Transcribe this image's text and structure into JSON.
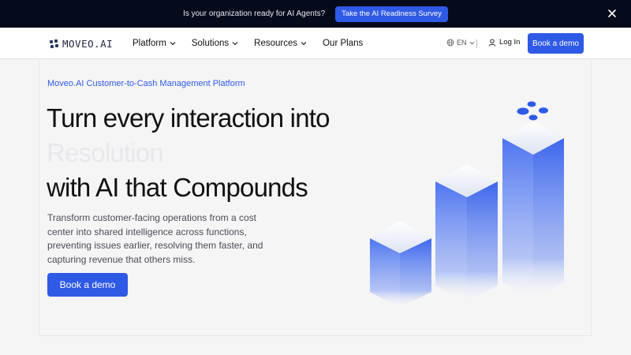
{
  "banner": {
    "text": "Is your organization ready for AI Agents?",
    "cta": "Take the AI Readiness Survey",
    "close_icon": "close-icon"
  },
  "nav": {
    "logo_text": "MOVEO.AI",
    "links": [
      {
        "label": "Platform",
        "has_menu": true
      },
      {
        "label": "Solutions",
        "has_menu": true
      },
      {
        "label": "Resources",
        "has_menu": true
      },
      {
        "label": "Our Plans",
        "has_menu": false
      }
    ],
    "language": "EN",
    "login": "Log In",
    "cta": "Book a demo"
  },
  "hero": {
    "eyebrow": "Moveo.AI Customer-to-Cash Management Platform",
    "title_line1": "Turn every interaction into",
    "title_line2": "Resolution",
    "title_line3": "with AI that Compounds",
    "description": "Transform customer-facing operations from a cost center into shared intelligence across functions, preventing issues earlier, resolving them faster, and capturing revenue that others miss.",
    "cta": "Book a demo"
  },
  "colors": {
    "accent": "#2f5ae6",
    "banner_bg": "#060b1c",
    "page_bg": "#f5f5f6"
  }
}
